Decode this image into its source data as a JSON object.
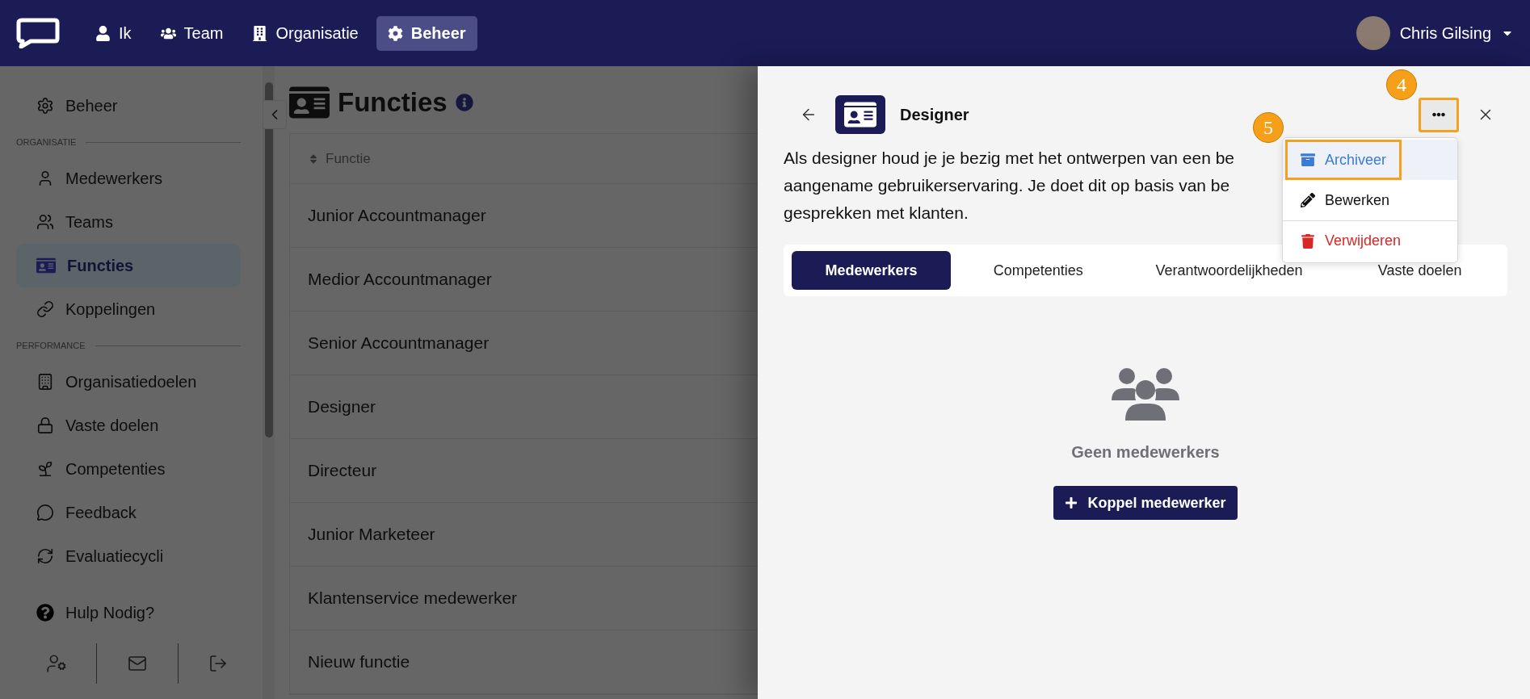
{
  "top_bar": {
    "nav": [
      {
        "label": "Ik",
        "selected": false
      },
      {
        "label": "Team",
        "selected": false
      },
      {
        "label": "Organisatie",
        "selected": false
      },
      {
        "label": "Beheer",
        "selected": true
      }
    ],
    "user": {
      "name": "Chris Gilsing"
    }
  },
  "sidebar": {
    "entries": [
      {
        "kind": "item",
        "label": "Beheer",
        "selected": false
      },
      {
        "kind": "section",
        "label": "ORGANISATIE"
      },
      {
        "kind": "item",
        "label": "Medewerkers",
        "selected": false
      },
      {
        "kind": "item",
        "label": "Teams",
        "selected": false
      },
      {
        "kind": "item",
        "label": "Functies",
        "selected": true
      },
      {
        "kind": "item",
        "label": "Koppelingen",
        "selected": false
      },
      {
        "kind": "section",
        "label": "PERFORMANCE"
      },
      {
        "kind": "item",
        "label": "Organisatiedoelen",
        "selected": false
      },
      {
        "kind": "item",
        "label": "Vaste doelen",
        "selected": false
      },
      {
        "kind": "item",
        "label": "Competenties",
        "selected": false
      },
      {
        "kind": "item",
        "label": "Feedback",
        "selected": false
      },
      {
        "kind": "item",
        "label": "Evaluatiecycli",
        "selected": false
      }
    ],
    "help": "Hulp Nodig?"
  },
  "page": {
    "title": "Functies",
    "table": {
      "columns": [
        "Functie"
      ],
      "rows": [
        "Junior Accountmanager",
        "Medior Accountmanager",
        "Senior Accountmanager",
        "Designer",
        "Directeur",
        "Junior Marketeer",
        "Klantenservice medewerker",
        "Nieuw functie"
      ]
    }
  },
  "panel": {
    "title": "Designer",
    "description": [
      "Als designer houd je je bezig met het ontwerpen van een be",
      "aangename gebruikerservaring. Je doet dit op basis van be",
      "gesprekken met klanten."
    ],
    "more_button": {
      "highlighted": true,
      "annotation": "4"
    },
    "more_menu": [
      {
        "kind": "archive",
        "label": "Archiveer",
        "highlighted": true,
        "annotation": "5"
      },
      {
        "kind": "edit",
        "label": "Bewerken",
        "highlighted": false
      },
      {
        "kind": "delete",
        "label": "Verwijderen",
        "highlighted": false
      }
    ],
    "tabs": [
      {
        "label": "Medewerkers",
        "selected": true
      },
      {
        "label": "Competenties",
        "selected": false
      },
      {
        "label": "Verantwoordelijkheden",
        "selected": false
      },
      {
        "label": "Vaste doelen",
        "selected": false
      }
    ],
    "empty_state": {
      "message": "Geen medewerkers",
      "button": "Koppel medewerker"
    }
  }
}
